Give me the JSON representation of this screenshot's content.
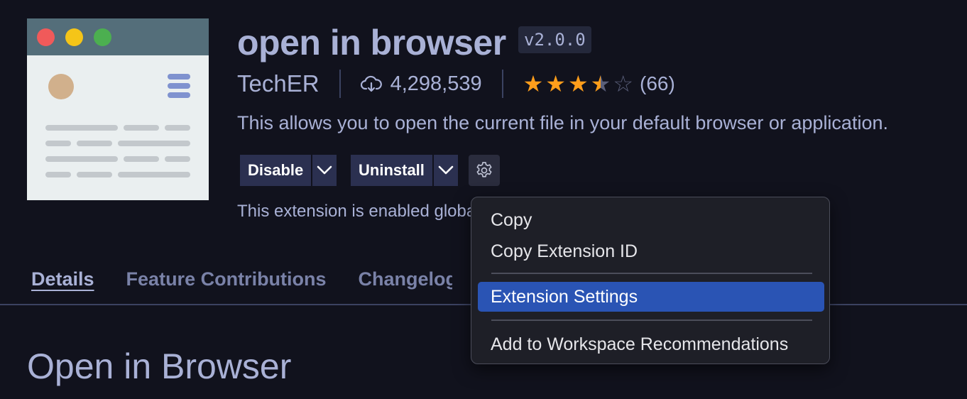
{
  "extension": {
    "title": "open in browser",
    "version": "v2.0.0",
    "publisher": "TechER",
    "installs": "4,298,539",
    "rating": 3.5,
    "rating_max": 5,
    "rating_count": "(66)",
    "description": "This allows you to open the current file in your default browser or application.",
    "status_text": "This extension is enabled globally."
  },
  "actions": {
    "disable_label": "Disable",
    "uninstall_label": "Uninstall"
  },
  "tabs": [
    {
      "label": "Details",
      "active": true
    },
    {
      "label": "Feature Contributions",
      "active": false
    },
    {
      "label": "Changelog",
      "active": false
    }
  ],
  "readme": {
    "heading": "Open in Browser"
  },
  "context_menu": {
    "items": [
      {
        "label": "Copy"
      },
      {
        "label": "Copy Extension ID"
      },
      {
        "label": "Extension Settings",
        "highlighted": true
      },
      {
        "label": "Add to Workspace Recommendations"
      }
    ]
  },
  "icons": {
    "installs": "cloud-download-icon",
    "settings": "gear-icon",
    "dropdown": "chevron-down-icon",
    "star": "star-icon"
  },
  "colors": {
    "background": "#11121d",
    "text": "#a9b1d6",
    "star": "#ff9e1b",
    "button": "#2b3050",
    "menu_highlight": "#2a54b4"
  }
}
